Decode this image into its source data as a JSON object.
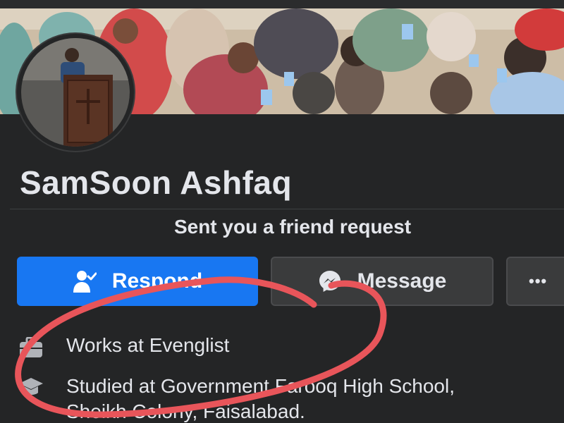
{
  "profile": {
    "name": "SamSoon Ashfaq",
    "request_text": "Sent you a friend request"
  },
  "actions": {
    "respond_label": "Respond",
    "message_label": "Message",
    "more_label": "•••"
  },
  "about": {
    "work": "Works at Evenglist",
    "education_line1": "Studied at Government Farooq High School,",
    "education_line2": "Sheikh Colony, Faisalabad."
  },
  "colors": {
    "background": "#242526",
    "primary_button": "#1877f2",
    "secondary_button": "#3a3b3c",
    "annotation": "#e8555a"
  },
  "icons": {
    "respond": "person-check-icon",
    "message": "messenger-icon",
    "more": "more-dots-icon",
    "work": "briefcase-icon",
    "education": "graduation-cap-icon"
  }
}
